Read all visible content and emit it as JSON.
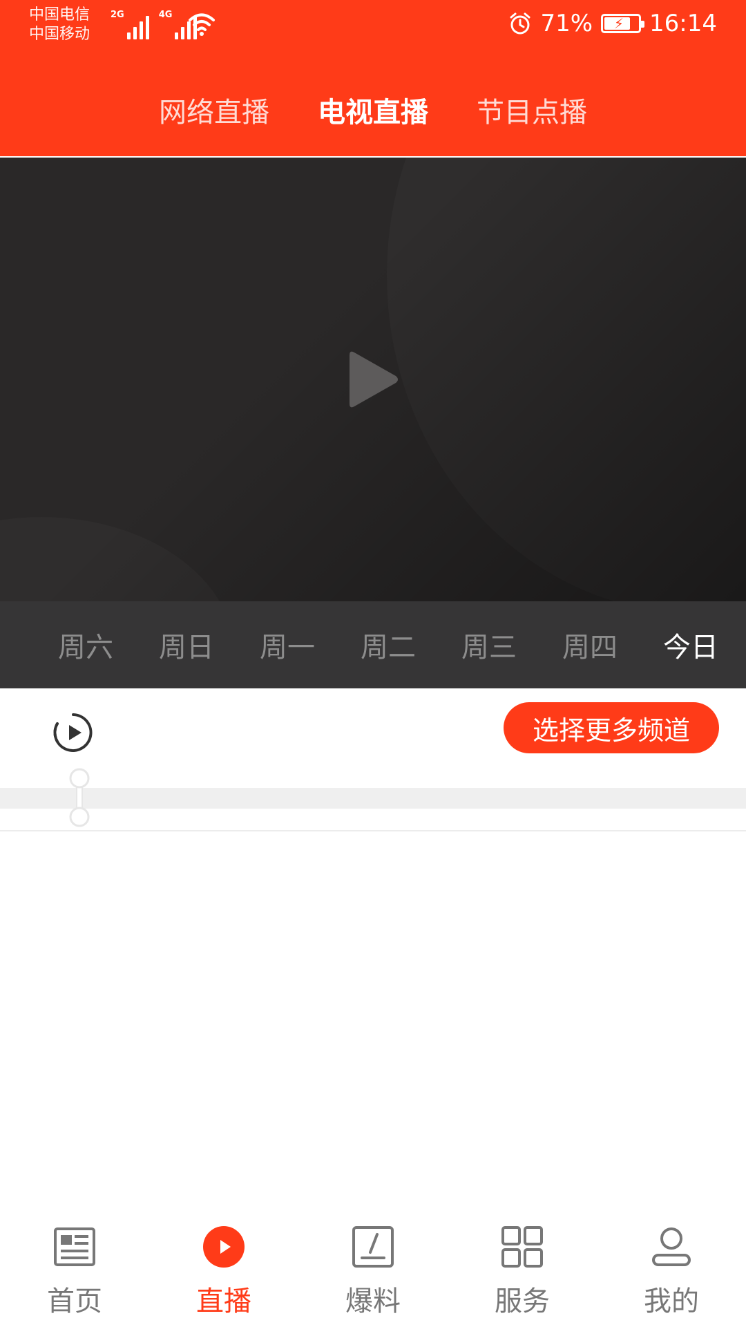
{
  "status_bar": {
    "carrier_1": "中国电信",
    "carrier_2": "中国移动",
    "net_1": "2G",
    "net_2": "4G",
    "battery": "71%",
    "time": "16:14"
  },
  "top_tabs": [
    {
      "label": "网络直播",
      "active": false
    },
    {
      "label": "电视直播",
      "active": true
    },
    {
      "label": "节目点播",
      "active": false
    }
  ],
  "days": [
    {
      "label": "周六",
      "active": false
    },
    {
      "label": "周日",
      "active": false
    },
    {
      "label": "周一",
      "active": false
    },
    {
      "label": "周二",
      "active": false
    },
    {
      "label": "周三",
      "active": false
    },
    {
      "label": "周四",
      "active": false
    },
    {
      "label": "今日",
      "active": true
    }
  ],
  "channel_strip": {
    "more_channels_label": "选择更多频道"
  },
  "bottom_nav": [
    {
      "label": "首页",
      "icon": "news-icon",
      "active": false
    },
    {
      "label": "直播",
      "icon": "live-play-icon",
      "active": true
    },
    {
      "label": "爆料",
      "icon": "edit-icon",
      "active": false
    },
    {
      "label": "服务",
      "icon": "grid-icon",
      "active": false
    },
    {
      "label": "我的",
      "icon": "user-icon",
      "active": false
    }
  ],
  "colors": {
    "brand": "#ff3b18",
    "inactive_text": "#777777",
    "day_inactive": "#8d8d8d"
  }
}
